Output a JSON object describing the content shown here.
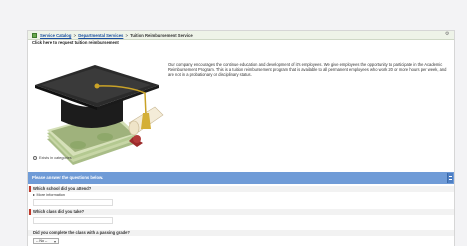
{
  "breadcrumb": {
    "items": [
      "Service Catalog",
      "Departmental Services",
      "Tuition Reimbursement Service"
    ],
    "separator": ">"
  },
  "header": {
    "request_link": "Click here to request tuition reimbursement"
  },
  "description": "Our company encourages the continue education and development of it's employees. We give employees the opportunity to participate in the Academic Reimbursement Program. This is a tuition reimbursement program that is available to all permanent employees who work 20 or more hours per week, and are not in a probationary or disciplinary status.",
  "categories": {
    "label": "Exists in categories"
  },
  "questions": {
    "header": "Please answer the questions below.",
    "items": [
      {
        "label": "Which school did you attend?",
        "more_info": "More information"
      },
      {
        "label": "Which class did you take?"
      },
      {
        "label": "Did you complete the class with a passing grade?",
        "select_value": "-- No --"
      }
    ]
  },
  "colors": {
    "accent_blue": "#6f9bd7",
    "link_blue": "#1a4fa0",
    "mandatory_red": "#c0392b"
  }
}
